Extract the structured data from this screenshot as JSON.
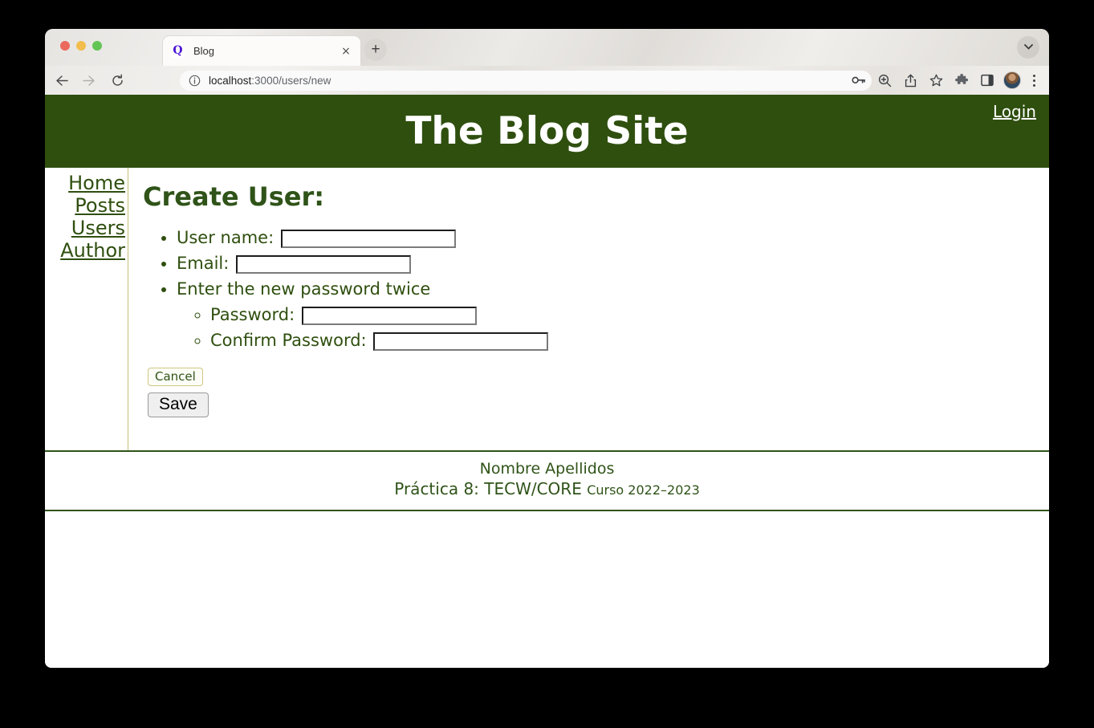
{
  "browser": {
    "tab": {
      "title": "Blog",
      "favicon_letter": "Q",
      "close_label": "×"
    },
    "new_tab_label": "+",
    "window_chevron": "▼",
    "url": {
      "host": "localhost",
      "path": ":3000/users/new"
    },
    "nav": {
      "back": "←",
      "forward": "→",
      "reload": "↻"
    },
    "icons": {
      "site_info": "info-icon",
      "password_key": "key-icon",
      "zoom": "zoom-search-icon",
      "share": "share-icon",
      "bookmark": "star-icon",
      "extensions": "puzzle-icon",
      "side_panel": "side-panel-icon",
      "avatar": "avatar-icon",
      "menu": "three-dot-menu-icon"
    }
  },
  "site": {
    "title": "The Blog Site",
    "login_label": "Login",
    "header_color": "#2f4f0f",
    "accent_color": "#2f5318"
  },
  "sidebar": {
    "items": [
      {
        "label": "Home"
      },
      {
        "label": "Posts"
      },
      {
        "label": "Users"
      },
      {
        "label": "Author"
      }
    ]
  },
  "main": {
    "page_title": "Create User:",
    "fields": [
      {
        "label": "User name:",
        "value": "",
        "placeholder": ""
      },
      {
        "label": "Email:",
        "value": "",
        "placeholder": ""
      }
    ],
    "password_group": {
      "label": "Enter the new password twice",
      "fields": [
        {
          "label": "Password:",
          "value": "",
          "placeholder": ""
        },
        {
          "label": "Confirm Password:",
          "value": "",
          "placeholder": ""
        }
      ]
    },
    "actions": {
      "cancel_label": "Cancel",
      "save_label": "Save"
    }
  },
  "footer": {
    "author": "Nombre Apellidos",
    "practice": "Práctica 8: TECW/CORE",
    "course": "Curso 2022–2023"
  }
}
